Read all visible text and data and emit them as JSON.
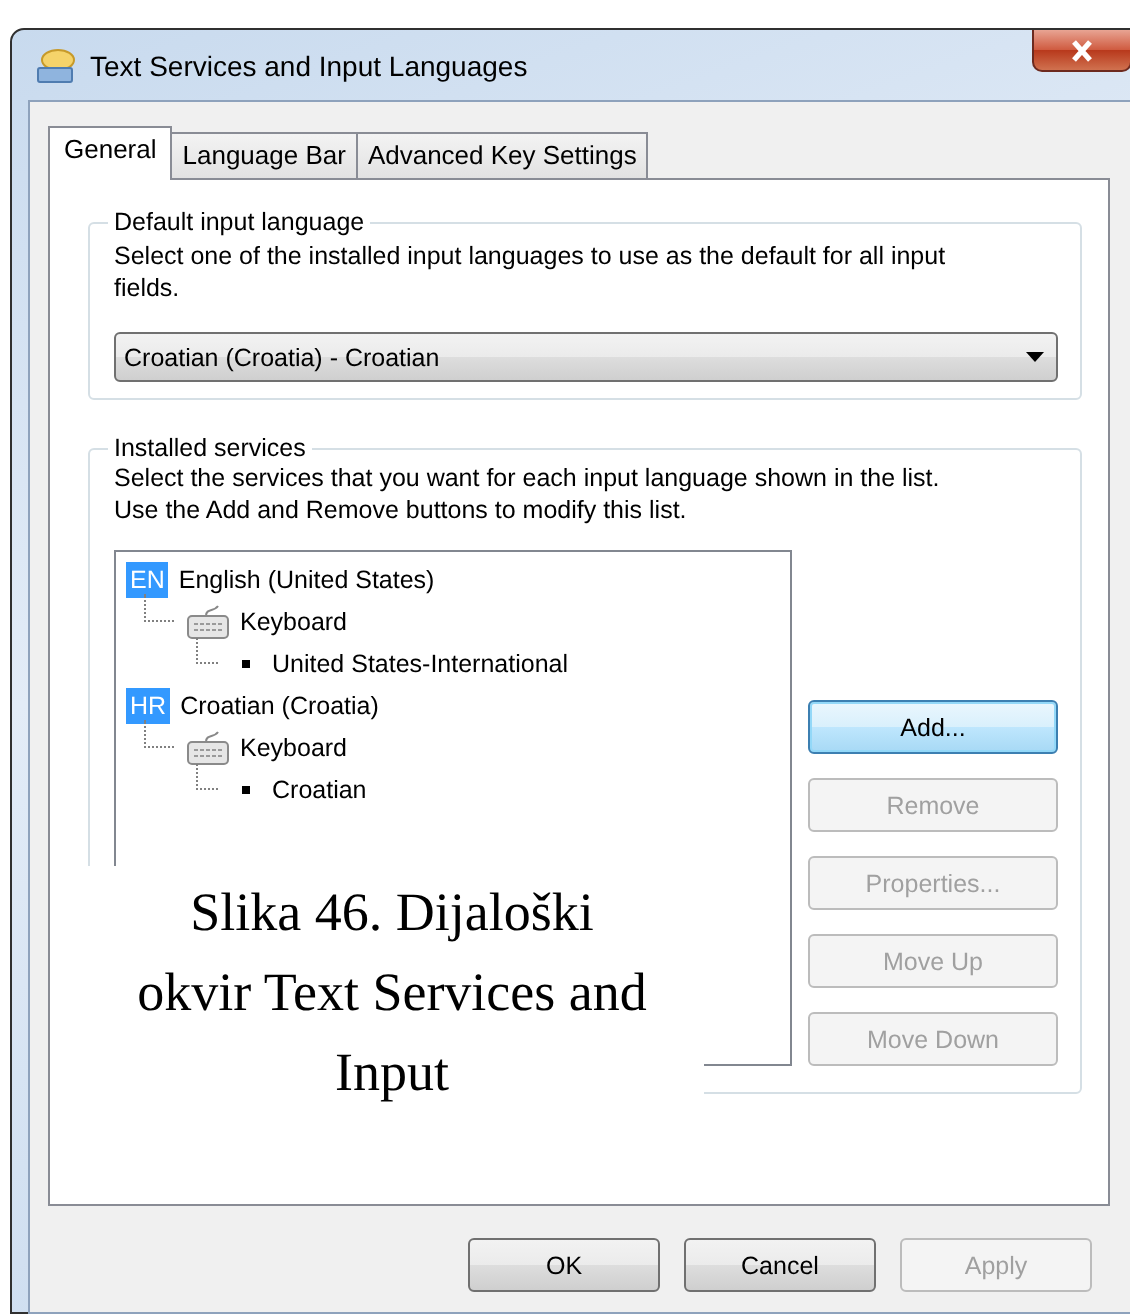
{
  "window": {
    "title": "Text Services and Input Languages"
  },
  "tabs": [
    {
      "label": "General",
      "selected": true
    },
    {
      "label": "Language Bar",
      "selected": false
    },
    {
      "label": "Advanced Key Settings",
      "selected": false
    }
  ],
  "default_input_language": {
    "legend": "Default input language",
    "description": "Select one of the installed input languages to use as the default for all input fields.",
    "dropdown": {
      "value": "Croatian (Croatia) - Croatian"
    }
  },
  "installed_services": {
    "legend": "Installed services",
    "description_lines": [
      "Select the services that you want for each input language shown in the list.",
      "Use the Add and Remove buttons to modify this list."
    ],
    "tree": [
      {
        "kind": "language",
        "badge": "EN",
        "label": "English (United States)",
        "children": [
          {
            "kind": "category",
            "label": "Keyboard",
            "children": [
              {
                "kind": "service",
                "label": "United States-International"
              }
            ]
          }
        ]
      },
      {
        "kind": "language",
        "badge": "HR",
        "label": "Croatian (Croatia)",
        "children": [
          {
            "kind": "category",
            "label": "Keyboard",
            "children": [
              {
                "kind": "service",
                "label": "Croatian"
              }
            ]
          }
        ]
      }
    ],
    "buttons": [
      {
        "label": "Add...",
        "disabled": false,
        "focused": true
      },
      {
        "label": "Remove",
        "disabled": true,
        "focused": false
      },
      {
        "label": "Properties...",
        "disabled": true,
        "focused": false
      },
      {
        "label": "Move Up",
        "disabled": true,
        "focused": false
      },
      {
        "label": "Move Down",
        "disabled": true,
        "focused": false
      }
    ]
  },
  "dialog_buttons": [
    {
      "label": "OK",
      "disabled": false
    },
    {
      "label": "Cancel",
      "disabled": false
    },
    {
      "label": "Apply",
      "disabled": true
    }
  ],
  "caption": {
    "text": "Slika 46. Dijaloški\nokvir Text Services and\nInput"
  }
}
